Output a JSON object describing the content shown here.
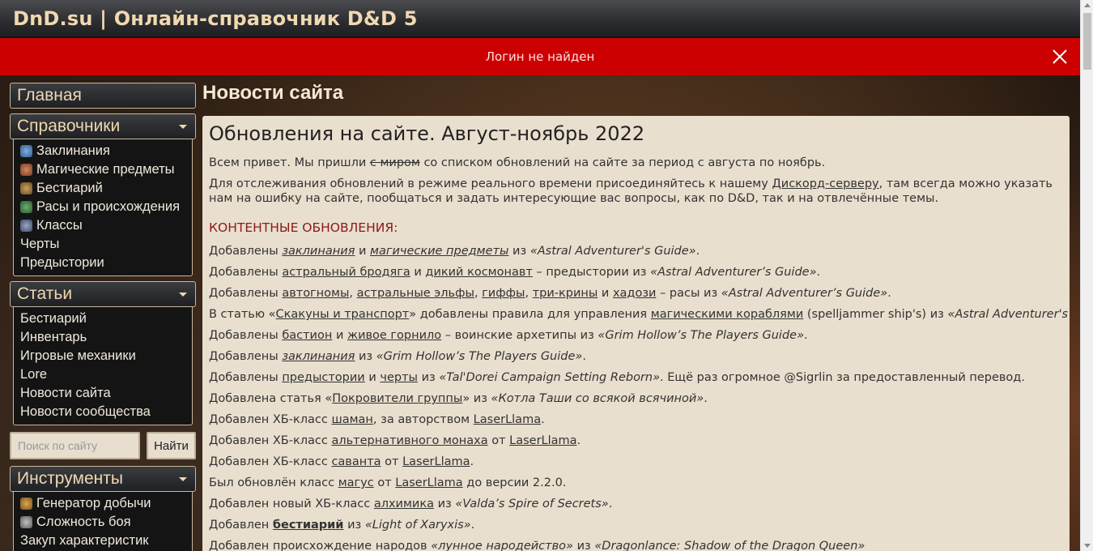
{
  "header": {
    "title": "DnD.su | Онлайн-справочник D&D 5"
  },
  "alert": {
    "message": "Логин не найден"
  },
  "sidebar": {
    "home": "Главная",
    "references": {
      "label": "Справочники",
      "items": [
        {
          "label": "Заклинания",
          "icon": "spell-icon"
        },
        {
          "label": "Магические предметы",
          "icon": "potion-icon"
        },
        {
          "label": "Бестиарий",
          "icon": "monster-icon"
        },
        {
          "label": "Расы и происхождения",
          "icon": "race-icon"
        },
        {
          "label": "Классы",
          "icon": "helmet-icon"
        },
        {
          "label": "Черты"
        },
        {
          "label": "Предыстории"
        }
      ]
    },
    "articles": {
      "label": "Статьи",
      "items": [
        "Бестиарий",
        "Инвентарь",
        "Игровые механики",
        "Lore",
        "Новости сайта",
        "Новости сообщества"
      ]
    },
    "search": {
      "placeholder": "Поиск по сайту",
      "button": "Найти"
    },
    "tools": {
      "label": "Инструменты",
      "items": [
        {
          "label": "Генератор добычи",
          "icon": "chest-icon"
        },
        {
          "label": "Сложность боя",
          "icon": "swords-icon"
        },
        {
          "label": "Закуп характеристик"
        }
      ]
    }
  },
  "main": {
    "page_title": "Новости сайта",
    "article": {
      "title": "Обновления на сайте. Август-ноябрь 2022",
      "intro1_a": "Всем привет. Мы пришли ",
      "intro1_strike": "с миром",
      "intro1_b": " со списком обновлений на сайте за период с августа по ноябрь.",
      "intro2_a": "Для отслеживания обновлений в режиме реального времени присоединяйтесь к нашему ",
      "intro2_link": "Дискорд-серверу",
      "intro2_b": ", там всегда можно указать нам на ошибку на сайте, пообщаться и задать интересующие вас вопросы, как по D&D, так и на отвлечённые темы.",
      "section_title": "КОНТЕНТНЫЕ ОБНОВЛЕНИЯ:",
      "lines": {
        "l1": [
          "Добавлены ",
          "заклинания",
          " и ",
          "магические предметы",
          " из ",
          "«Astral Adventurer's Guide»",
          "."
        ],
        "l2": [
          "Добавлены ",
          "астральный бродяга",
          " и ",
          "дикий космонавт",
          " – предыстории из ",
          "«Astral Adventurer’s Guide»",
          "."
        ],
        "l3": [
          "Добавлены ",
          "автогномы",
          ", ",
          "астральные эльфы",
          ", ",
          "гиффы",
          ", ",
          "три-крины",
          " и ",
          "хадози",
          " – расы из ",
          "«Astral Adventurer’s Guide»",
          "."
        ],
        "l4": [
          "В статью «",
          "Скакуны и транспорт",
          "» добавлены правила для управления ",
          "магическими кораблями",
          " (spelljammer ship's) из ",
          "«Astral Adventurer's Guide»",
          "."
        ],
        "l5": [
          "Добавлены ",
          "бастион",
          " и ",
          "живое горнило",
          " – воинские архетипы из ",
          "«Grim Hollow’s The Players Guide»",
          "."
        ],
        "l6": [
          "Добавлены ",
          "заклинания",
          " из ",
          "«Grim Hollow’s The Players Guide»",
          "."
        ],
        "l7": [
          "Добавлены ",
          "предыстории",
          " и ",
          "черты",
          " из ",
          "«Tal'Dorei Campaign Setting Reborn»",
          ". Ещё раз огромное @Sigrlin за предоставленный перевод."
        ],
        "l8": [
          "Добавлена статья «",
          "Покровители группы",
          "» из ",
          "«Котла Таши со всякой всячиной»",
          "."
        ],
        "l9": [
          "Добавлен ХБ-класс ",
          "шаман",
          ", за авторством ",
          "LaserLlama",
          "."
        ],
        "l10": [
          "Добавлен ХБ-класс ",
          "альтернативного монаха",
          " от ",
          "LaserLlama",
          "."
        ],
        "l11": [
          "Добавлен ХБ-класс ",
          "саванта",
          " от ",
          "LaserLlama",
          "."
        ],
        "l12": [
          "Был обновлён класс ",
          "магус",
          " от ",
          "LaserLlama",
          " до версии 2.2.0."
        ],
        "l13": [
          "Добавлен новый ХБ-класс ",
          "алхимика",
          " из ",
          "«Valda’s Spire of Secrets»",
          "."
        ],
        "l14": [
          "Добавлен ",
          "бестиарий",
          " из ",
          "«Light of Xaryxis»",
          "."
        ],
        "l15": [
          "Добавлен происхождение народов ",
          "«лунное народейство»",
          " из ",
          "«Dragonlance: Shadow of the Dragon Queen»"
        ]
      }
    }
  }
}
